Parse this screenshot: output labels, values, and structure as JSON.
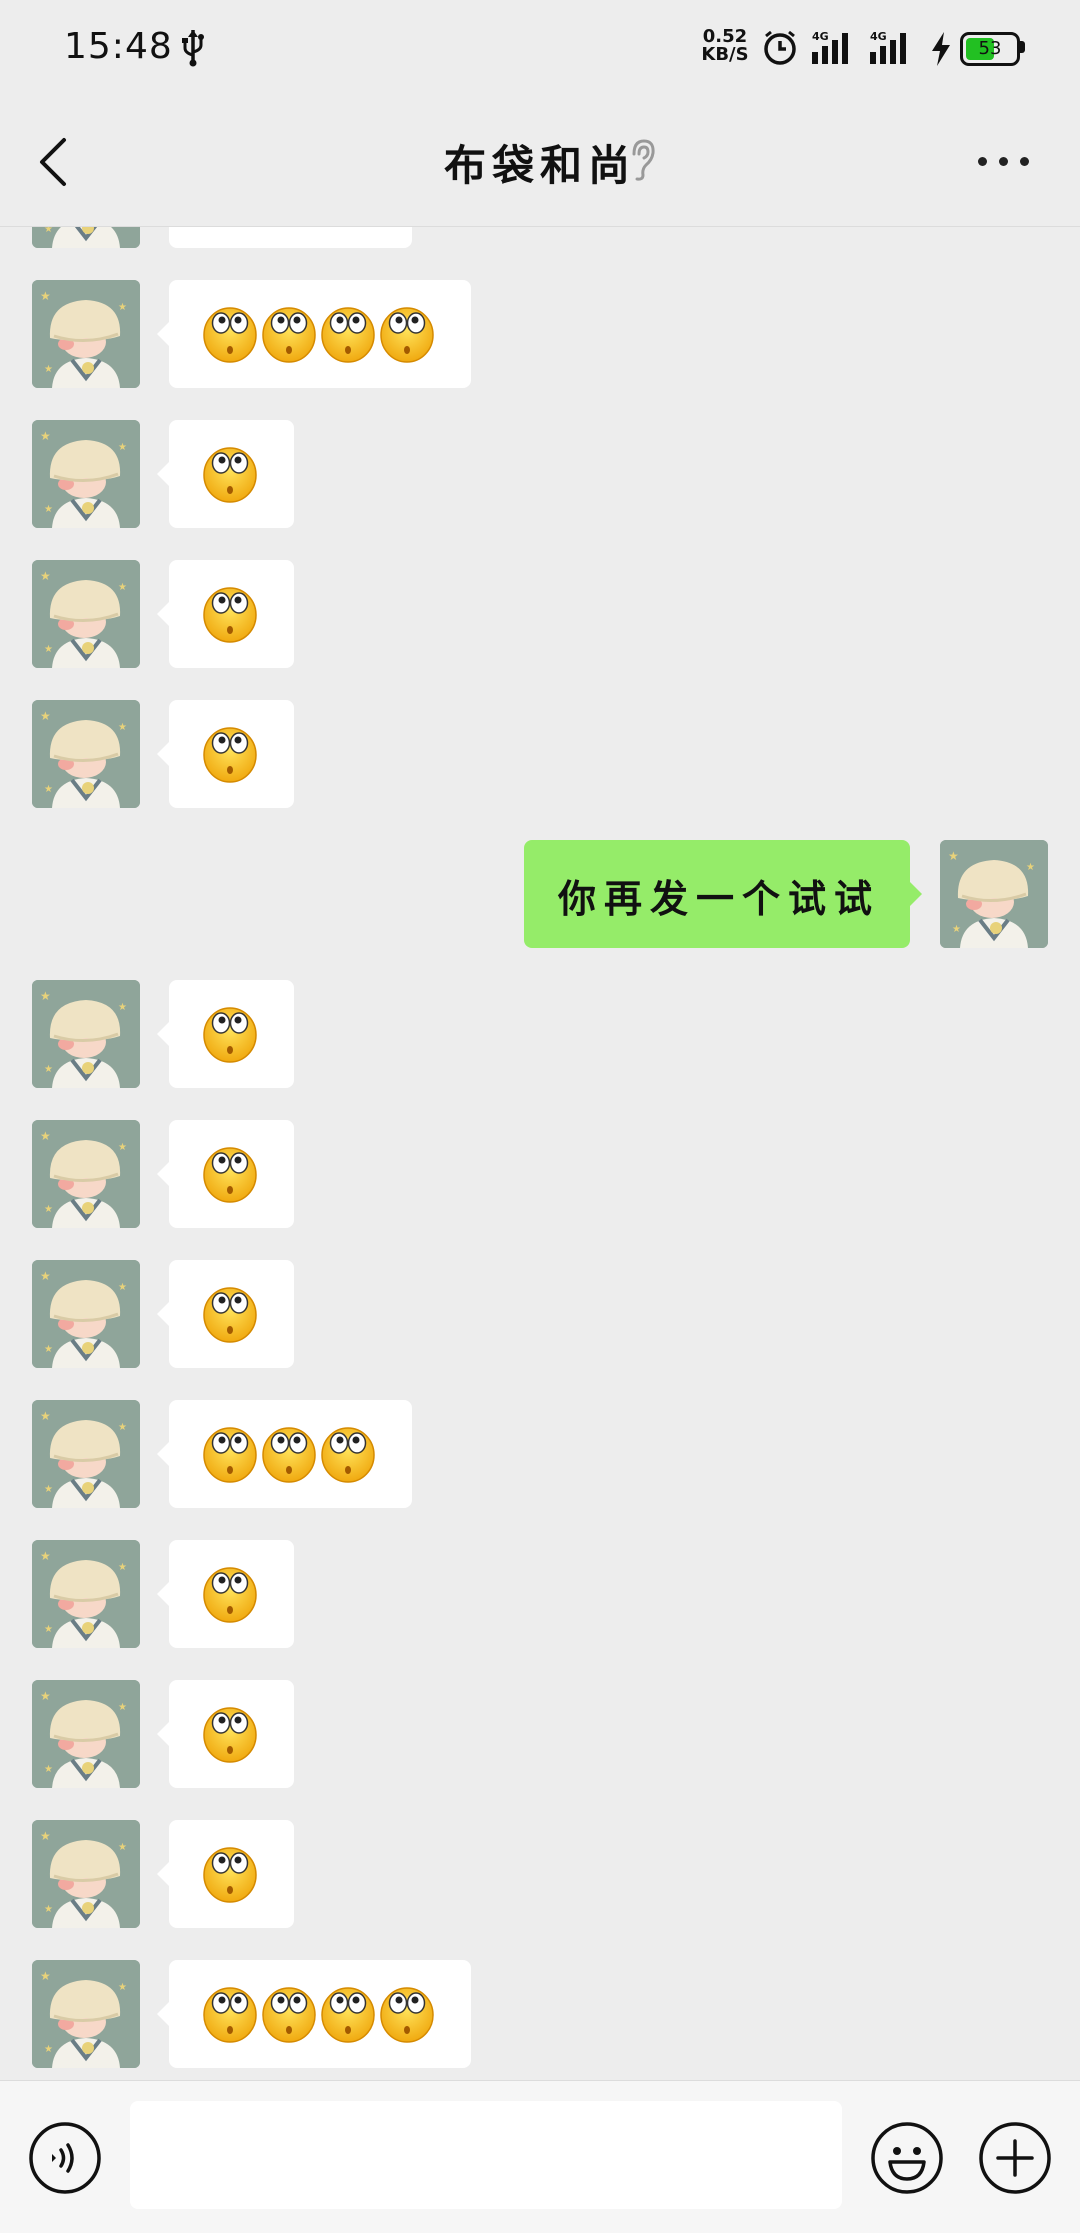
{
  "status_bar": {
    "time": "15:48",
    "net_speed_value": "0.52",
    "net_speed_unit": "KB/S",
    "network_1": "4G",
    "network_2": "4G",
    "battery": "53"
  },
  "header": {
    "title": "布袋和尚",
    "icons": [
      "back-arrow",
      "ear-receiver",
      "more-dots"
    ]
  },
  "messages": [
    {
      "dir": "in",
      "emoji_count": 3
    },
    {
      "dir": "in",
      "emoji_count": 4
    },
    {
      "dir": "in",
      "emoji_count": 1
    },
    {
      "dir": "in",
      "emoji_count": 1
    },
    {
      "dir": "in",
      "emoji_count": 1
    },
    {
      "dir": "out",
      "text": "你再发一个试试"
    },
    {
      "dir": "in",
      "emoji_count": 1
    },
    {
      "dir": "in",
      "emoji_count": 1
    },
    {
      "dir": "in",
      "emoji_count": 1
    },
    {
      "dir": "in",
      "emoji_count": 3
    },
    {
      "dir": "in",
      "emoji_count": 1
    },
    {
      "dir": "in",
      "emoji_count": 1
    },
    {
      "dir": "in",
      "emoji_count": 1
    },
    {
      "dir": "in",
      "emoji_count": 4
    }
  ],
  "emoji_name": "flushed-face",
  "input_bar": {
    "input_value": "",
    "icons": [
      "voice",
      "emoji",
      "plus"
    ]
  },
  "colors": {
    "background": "#ededed",
    "incoming_bubble": "#ffffff",
    "outgoing_bubble": "#95ec69",
    "battery": "#22c022"
  }
}
